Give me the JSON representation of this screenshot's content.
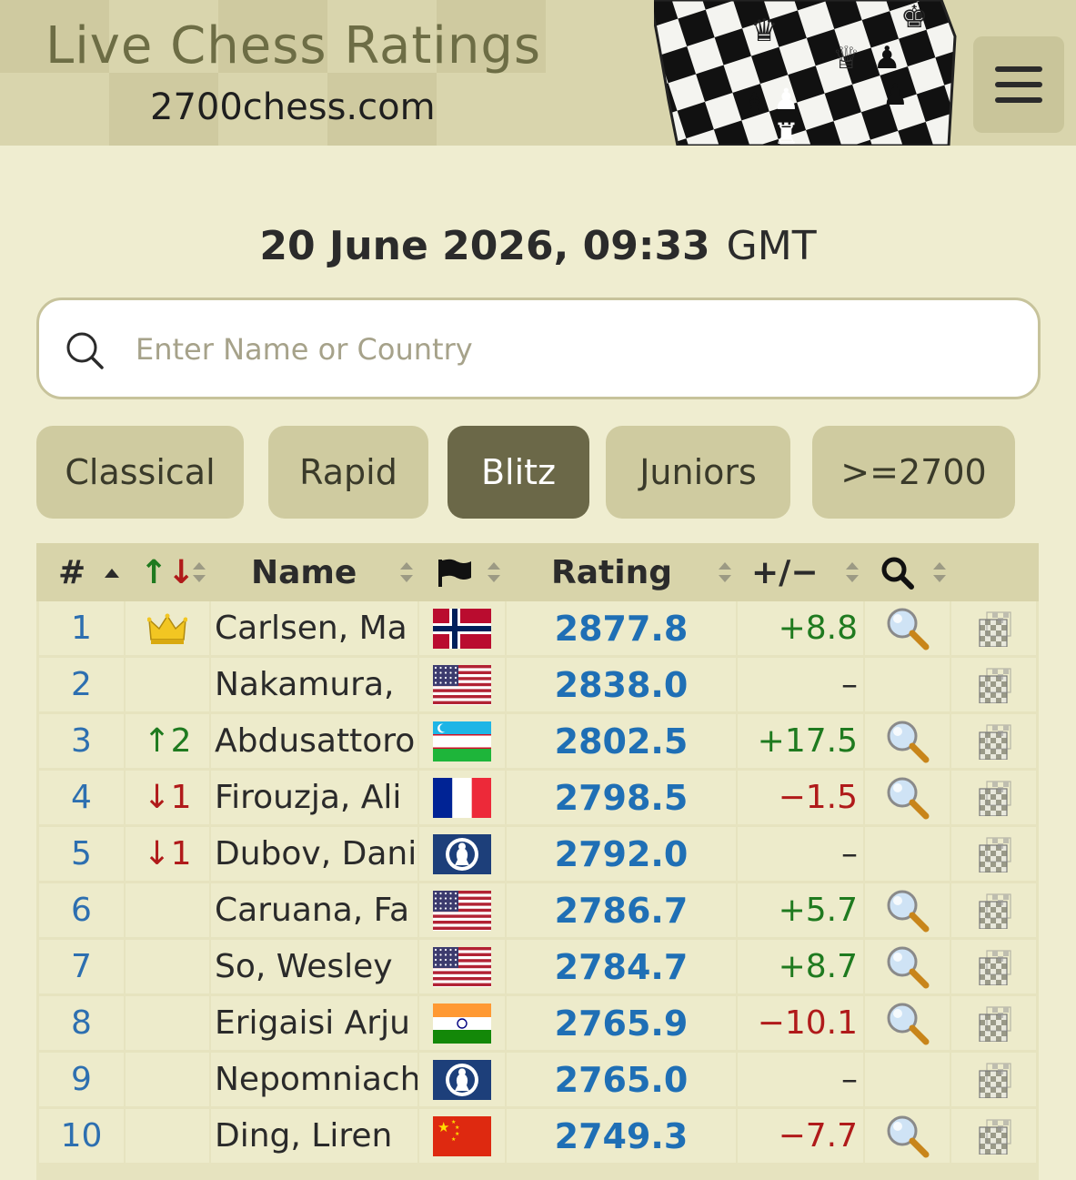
{
  "header": {
    "site_title": "Live Chess Ratings",
    "site_url": "2700chess.com",
    "menu_icon": "hamburger-menu-icon"
  },
  "datetime": {
    "date_time": "20 June 2026, 09:33",
    "timezone": "GMT"
  },
  "search": {
    "placeholder": "Enter Name or Country",
    "icon": "search-icon"
  },
  "tabs": [
    {
      "label": "Classical",
      "active": false
    },
    {
      "label": "Rapid",
      "active": false
    },
    {
      "label": "Blitz",
      "active": true
    },
    {
      "label": "Juniors",
      "active": false
    },
    {
      "label": ">=2700",
      "active": false
    }
  ],
  "table": {
    "columns": {
      "rank": "#",
      "change": "↑↓",
      "name": "Name",
      "flag": "flag-icon",
      "rating": "Rating",
      "diff": "+/−",
      "search": "magnifier-icon"
    },
    "rows": [
      {
        "rank": "1",
        "change": "",
        "crown": true,
        "name": "Carlsen, Ma",
        "flag": "norway",
        "rating": "2877.8",
        "diff": "+8.8",
        "lens": true
      },
      {
        "rank": "2",
        "change": "",
        "crown": false,
        "name": "Nakamura,",
        "flag": "usa",
        "rating": "2838.0",
        "diff": "–",
        "lens": false
      },
      {
        "rank": "3",
        "change": "↑2",
        "crown": false,
        "name": "Abdusattoro",
        "flag": "uzbekistan",
        "rating": "2802.5",
        "diff": "+17.5",
        "lens": true
      },
      {
        "rank": "4",
        "change": "↓1",
        "crown": false,
        "name": "Firouzja, Ali",
        "flag": "france",
        "rating": "2798.5",
        "diff": "−1.5",
        "lens": true
      },
      {
        "rank": "5",
        "change": "↓1",
        "crown": false,
        "name": "Dubov, Dani",
        "flag": "fide",
        "rating": "2792.0",
        "diff": "–",
        "lens": false
      },
      {
        "rank": "6",
        "change": "",
        "crown": false,
        "name": "Caruana, Fa",
        "flag": "usa",
        "rating": "2786.7",
        "diff": "+5.7",
        "lens": true
      },
      {
        "rank": "7",
        "change": "",
        "crown": false,
        "name": "So, Wesley",
        "flag": "usa",
        "rating": "2784.7",
        "diff": "+8.7",
        "lens": true
      },
      {
        "rank": "8",
        "change": "",
        "crown": false,
        "name": "Erigaisi Arju",
        "flag": "india",
        "rating": "2765.9",
        "diff": "−10.1",
        "lens": true
      },
      {
        "rank": "9",
        "change": "",
        "crown": false,
        "name": "Nepomniach",
        "flag": "fide",
        "rating": "2765.0",
        "diff": "–",
        "lens": false
      },
      {
        "rank": "10",
        "change": "",
        "crown": false,
        "name": "Ding, Liren",
        "flag": "china",
        "rating": "2749.3",
        "diff": "−7.7",
        "lens": true
      }
    ]
  },
  "colors": {
    "page_bg": "#efedd0",
    "active_tab": "#6b6848",
    "rating_blue": "#1f6fb5",
    "positive_green": "#1f7a1f",
    "negative_red": "#b01a1a"
  }
}
